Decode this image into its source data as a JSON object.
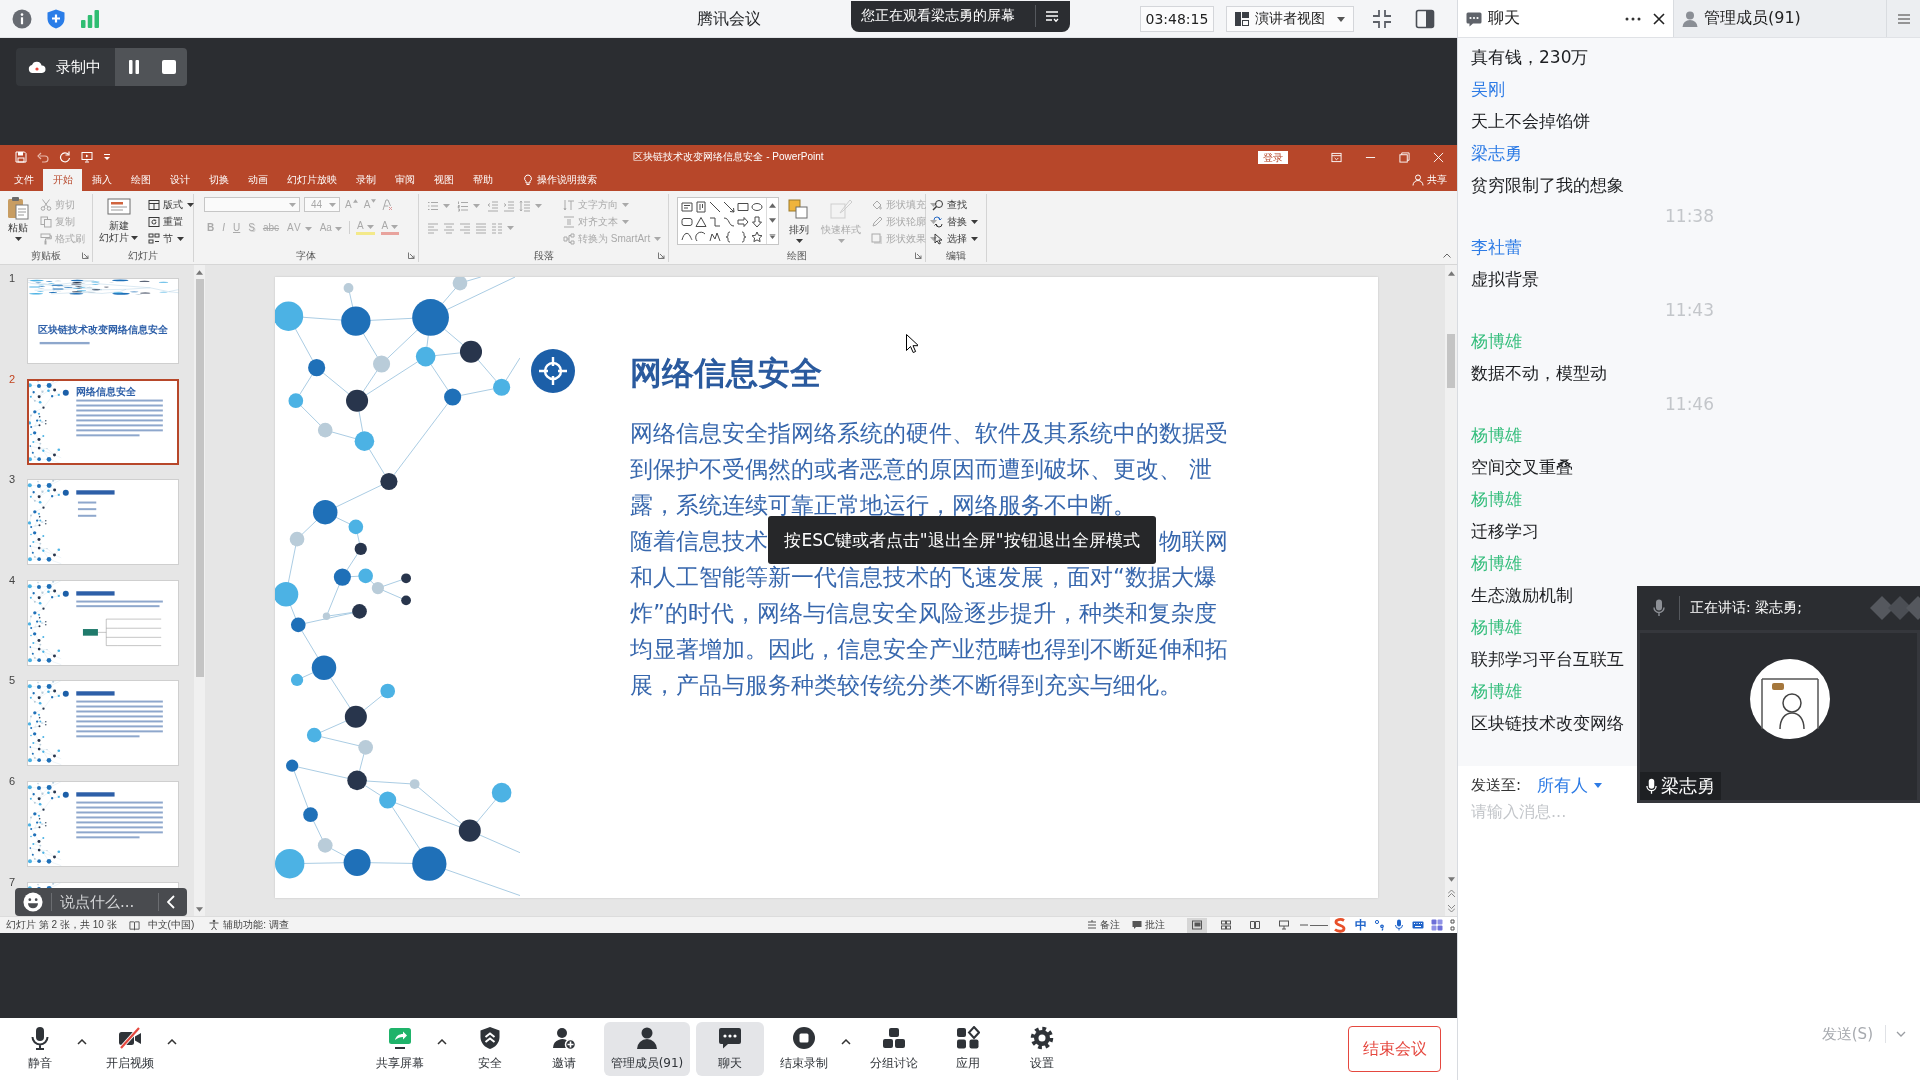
{
  "top_bar": {
    "title": "腾讯会议",
    "share_banner": "您正在观看梁志勇的屏幕",
    "timer": "03:48:15",
    "view_mode": "演讲者视图"
  },
  "recording": {
    "label": "录制中"
  },
  "powerpoint": {
    "title": "区块链技术改变网络信息安全 - PowerPoint",
    "sign_in": "登录",
    "tabs": [
      {
        "label": "文件",
        "selected": false
      },
      {
        "label": "开始",
        "selected": true
      },
      {
        "label": "插入",
        "selected": false
      },
      {
        "label": "绘图",
        "selected": false
      },
      {
        "label": "设计",
        "selected": false
      },
      {
        "label": "切换",
        "selected": false
      },
      {
        "label": "动画",
        "selected": false
      },
      {
        "label": "幻灯片放映",
        "selected": false
      },
      {
        "label": "录制",
        "selected": false
      },
      {
        "label": "审阅",
        "selected": false
      },
      {
        "label": "视图",
        "selected": false
      },
      {
        "label": "帮助",
        "selected": false
      }
    ],
    "tell_me": "操作说明搜索",
    "share": "共享",
    "ribbon": [
      {
        "label": "剪贴板",
        "items": [
          {
            "label": "粘贴",
            "disabled": false
          },
          {
            "label": "剪切",
            "disabled": true
          },
          {
            "label": "复制",
            "disabled": true
          },
          {
            "label": "格式刷",
            "disabled": true
          }
        ]
      },
      {
        "label": "幻灯片",
        "items": [
          {
            "lines": [
              "新建",
              "幻灯片"
            ],
            "disabled": false
          },
          {
            "label": "版式",
            "disabled": false
          },
          {
            "label": "重置",
            "disabled": false
          },
          {
            "label": "节",
            "disabled": false
          }
        ]
      },
      {
        "label": "字体",
        "disabled": true,
        "font_size": "44",
        "buttons": [
          "A",
          "A",
          "B",
          "I",
          "U",
          "S",
          "abc",
          "AV",
          "Aa",
          "A",
          "A"
        ]
      },
      {
        "label": "段落",
        "disabled": true,
        "items": [
          {
            "label": "文字方向",
            "disabled": true
          },
          {
            "label": "对齐文本",
            "disabled": true
          },
          {
            "label": "转换为 SmartArt",
            "disabled": true
          }
        ]
      },
      {
        "label": "绘图",
        "items": [
          {
            "label": "排列",
            "disabled": false
          },
          {
            "label": "快速样式",
            "disabled": true
          },
          {
            "label": "形状填充",
            "disabled": true
          },
          {
            "label": "形状轮廓",
            "disabled": true
          },
          {
            "label": "形状效果",
            "disabled": true
          }
        ]
      },
      {
        "label": "编辑",
        "items": [
          {
            "label": "查找",
            "disabled": false
          },
          {
            "label": "替换",
            "disabled": false
          },
          {
            "label": "选择",
            "disabled": false
          }
        ]
      }
    ],
    "slides": [
      {
        "number": "1",
        "kind": "title",
        "title": "区块链技术改变网络信息安全",
        "selected": false
      },
      {
        "number": "2",
        "kind": "content",
        "title": "网络信息安全",
        "selected": true
      },
      {
        "number": "3",
        "kind": "list",
        "selected": false
      },
      {
        "number": "4",
        "kind": "diagram",
        "selected": false
      },
      {
        "number": "5",
        "kind": "content",
        "selected": false
      },
      {
        "number": "6",
        "kind": "content",
        "selected": false
      },
      {
        "number": "7",
        "kind": "content",
        "selected": false
      }
    ],
    "slide": {
      "title": "网络信息安全",
      "paragraphs": [
        {
          "text": "网络信息安全指网络系统的硬件、软件及其系统中的数据受到保护不受偶然的或者恶意的原因而遭到破坏、更改、 泄露，系统连续可靠正常地运行，网络服务不中断。"
        },
        {
          "text": "随着信息技术",
          "text_after_toast": "物联网",
          "continued": "和人工智能等新一代信息技术的飞速发展，面对“数据大爆炸”的时代，网络与信息安全风险逐步提升，种类和复杂度均显著增加。因此，信息安全产业范畴也得到不断延伸和拓展，产品与服务种类较传统分类不断得到充实与细化。"
        }
      ]
    },
    "status_bar": {
      "position": "幻灯片 第 2 张，共 10 张",
      "language": "中文(中国)",
      "accessibility": "辅助功能: 调查",
      "notes": "备注",
      "comments": "批注",
      "views": [
        {
          "selected": true
        },
        {
          "selected": false
        },
        {
          "selected": false
        },
        {
          "selected": false
        }
      ]
    }
  },
  "ime": {
    "mode": "中"
  },
  "toast": "按ESC键或者点击\"退出全屏\"按钮退出全屏模式",
  "comment_bar": {
    "placeholder": "说点什么..."
  },
  "toolbar": {
    "items": [
      {
        "label": "静音",
        "has_menu": true,
        "selected": false
      },
      {
        "label": "开启视频",
        "has_menu": true,
        "selected": false
      },
      {
        "label": "共享屏幕",
        "has_menu": true,
        "selected": false
      },
      {
        "label": "安全",
        "has_menu": false,
        "selected": false
      },
      {
        "label": "邀请",
        "has_menu": false,
        "selected": false
      },
      {
        "label": "管理成员(91)",
        "has_menu": false,
        "selected": true
      },
      {
        "label": "聊天",
        "has_menu": false,
        "selected": true
      },
      {
        "label": "结束录制",
        "has_menu": true,
        "selected": false
      },
      {
        "label": "分组讨论",
        "has_menu": false,
        "selected": false
      },
      {
        "label": "应用",
        "has_menu": false,
        "selected": false
      },
      {
        "label": "设置",
        "has_menu": false,
        "selected": false
      }
    ],
    "end_button": "结束会议"
  },
  "chat": {
    "tabs": [
      {
        "label": "聊天",
        "selected": true
      },
      {
        "label": "管理成员(91)",
        "selected": false
      }
    ],
    "lines": [
      {
        "kind": "text",
        "text": "真有钱，230万"
      },
      {
        "kind": "name",
        "text": "吴刚",
        "color": "#2d7be5"
      },
      {
        "kind": "text",
        "text": "天上不会掉馅饼"
      },
      {
        "kind": "name",
        "text": "梁志勇",
        "color": "#2d7be5"
      },
      {
        "kind": "text",
        "text": "贫穷限制了我的想象"
      },
      {
        "kind": "time",
        "text": "11:38"
      },
      {
        "kind": "name",
        "text": "李社蕾",
        "color": "#2d7be5"
      },
      {
        "kind": "text",
        "text": "虚拟背景"
      },
      {
        "kind": "time",
        "text": "11:43"
      },
      {
        "kind": "name",
        "text": "杨博雄",
        "color": "#33bd7b"
      },
      {
        "kind": "text",
        "text": "数据不动，模型动"
      },
      {
        "kind": "time",
        "text": "11:46"
      },
      {
        "kind": "name",
        "text": "杨博雄",
        "color": "#33bd7b"
      },
      {
        "kind": "text",
        "text": "空间交叉重叠"
      },
      {
        "kind": "name",
        "text": "杨博雄",
        "color": "#33bd7b"
      },
      {
        "kind": "text",
        "text": "迁移学习"
      },
      {
        "kind": "name",
        "text": "杨博雄",
        "color": "#33bd7b"
      },
      {
        "kind": "text",
        "text": "生态激励机制"
      },
      {
        "kind": "name",
        "text": "杨博雄",
        "color": "#33bd7b"
      },
      {
        "kind": "text",
        "text": "联邦学习平台互联互"
      },
      {
        "kind": "name",
        "text": "杨博雄",
        "color": "#33bd7b"
      },
      {
        "kind": "text",
        "text": "区块链技术改变网络"
      }
    ],
    "send_to_label": "发送至:",
    "recipient": "所有人",
    "input": {
      "placeholder": "请输入消息..."
    },
    "send_button": {
      "label": "发送(S)",
      "disabled": true
    }
  },
  "speaker_window": {
    "status": "正在讲话: 梁志勇;",
    "name": "梁志勇"
  }
}
